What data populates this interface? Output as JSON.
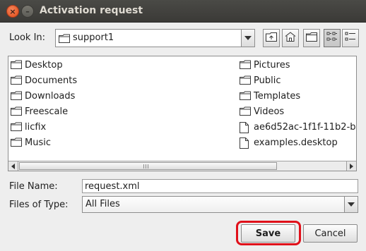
{
  "window": {
    "title": "Activation request",
    "close_glyph": "×",
    "minimize_glyph": "–"
  },
  "lookin": {
    "label": "Look In:",
    "value": "support1",
    "icon": "folder-icon"
  },
  "toolbar": {
    "buttons": [
      {
        "name": "up-one-level-button",
        "icon": "folder-up-icon"
      },
      {
        "name": "home-button",
        "icon": "home-icon"
      },
      {
        "name": "new-folder-button",
        "icon": "new-folder-icon"
      },
      {
        "name": "list-view-button",
        "icon": "list-view-icon",
        "selected": true
      },
      {
        "name": "details-view-button",
        "icon": "details-view-icon"
      }
    ]
  },
  "files": {
    "column1": [
      {
        "label": "Desktop",
        "icon": "folder-icon"
      },
      {
        "label": "Documents",
        "icon": "folder-icon"
      },
      {
        "label": "Downloads",
        "icon": "folder-icon"
      },
      {
        "label": "Freescale",
        "icon": "folder-icon"
      },
      {
        "label": "licfix",
        "icon": "folder-icon"
      },
      {
        "label": "Music",
        "icon": "folder-icon"
      }
    ],
    "column2": [
      {
        "label": "Pictures",
        "icon": "folder-icon"
      },
      {
        "label": "Public",
        "icon": "folder-icon"
      },
      {
        "label": "Templates",
        "icon": "folder-icon"
      },
      {
        "label": "Videos",
        "icon": "folder-icon"
      },
      {
        "label": "ae6d52ac-1f1f-11b2-b",
        "icon": "file-icon"
      },
      {
        "label": "examples.desktop",
        "icon": "file-icon"
      }
    ]
  },
  "filename": {
    "label": "File Name:",
    "value": "request.xml"
  },
  "filetype": {
    "label": "Files of Type:",
    "value": "All Files"
  },
  "buttons": {
    "save": "Save",
    "cancel": "Cancel"
  },
  "colors": {
    "highlight": "#e0101a",
    "titlebar": "#3c3b37"
  }
}
